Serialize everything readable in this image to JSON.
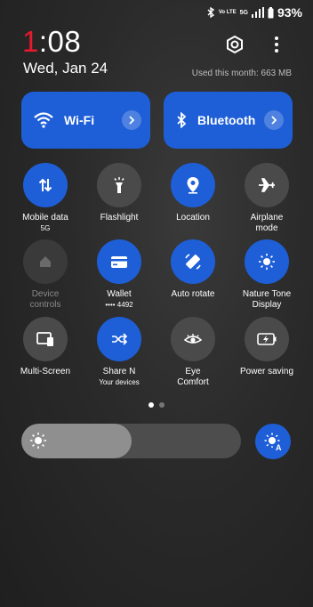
{
  "status": {
    "battery": "93%",
    "network_label": "Vo LTE",
    "network_label2": "5G"
  },
  "clock": {
    "hour_first": "1",
    "rest": ":08"
  },
  "date": "Wed, Jan 24",
  "usage": "Used this month: 663 MB",
  "tiles": {
    "wifi": {
      "label": "Wi-Fi",
      "icon": "wifi-icon"
    },
    "bluetooth": {
      "label": "Bluetooth",
      "icon": "bluetooth-icon"
    }
  },
  "toggles": [
    {
      "label": "Mobile data",
      "sub": "5G",
      "state": "on"
    },
    {
      "label": "Flashlight",
      "sub": "",
      "state": "off"
    },
    {
      "label": "Location",
      "sub": "",
      "state": "on"
    },
    {
      "label": "Airplane",
      "sub": "mode",
      "state": "off"
    },
    {
      "label": "Device",
      "sub": "controls",
      "state": "disabled"
    },
    {
      "label": "Wallet",
      "sub": "•••• 4492",
      "state": "on"
    },
    {
      "label": "Auto rotate",
      "sub": "",
      "state": "on"
    },
    {
      "label": "Nature Tone",
      "sub": "Display",
      "state": "on"
    },
    {
      "label": "Multi-Screen",
      "sub": "",
      "state": "off"
    },
    {
      "label": "Share N",
      "sub": "Your devices",
      "state": "on"
    },
    {
      "label": "Eye",
      "sub": "Comfort",
      "state": "off"
    },
    {
      "label": "Power saving",
      "sub": "",
      "state": "off"
    }
  ],
  "pager": {
    "pages": 2,
    "current": 1
  },
  "brightness": {
    "level": 0.5
  },
  "colors": {
    "accent": "#1e5fd8",
    "clock_red": "#e8192c",
    "toggle_off": "#4a4a4a"
  }
}
